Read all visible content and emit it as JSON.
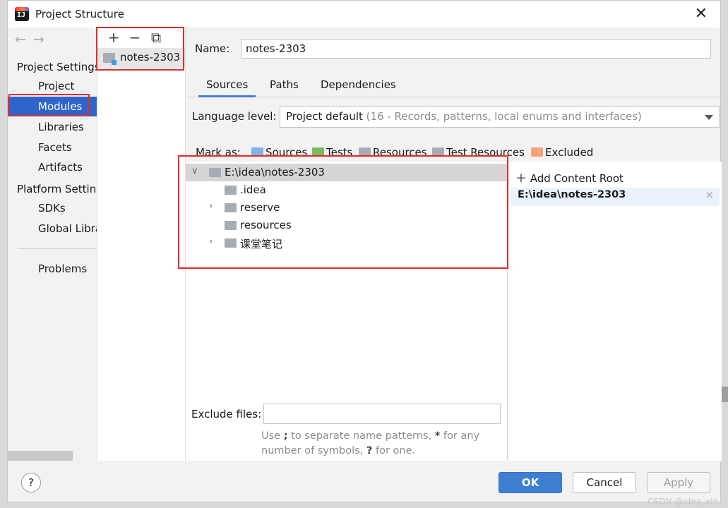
{
  "window": {
    "title": "Project Structure",
    "close": "✕"
  },
  "nav": {
    "project_settings": "Project Settings",
    "items1": [
      "Project",
      "Modules",
      "Libraries",
      "Facets",
      "Artifacts"
    ],
    "platform_settings": "Platform Settings",
    "items2": [
      "SDKs",
      "Global Libraries"
    ],
    "problems": "Problems",
    "selected": "Modules"
  },
  "modules": {
    "toolbar": {
      "add": "+",
      "remove": "−",
      "copy": "⧉"
    },
    "list": [
      "notes-2303"
    ]
  },
  "name": {
    "label": "Name:",
    "value": "notes-2303"
  },
  "tabs": [
    "Sources",
    "Paths",
    "Dependencies"
  ],
  "language": {
    "label": "Language level:",
    "value": "Project default",
    "detail": "(16 - Records, patterns, local enums and interfaces)"
  },
  "mark_as": {
    "label": "Mark as:",
    "buttons": [
      {
        "label": "Sources",
        "color": "#7fb2e5"
      },
      {
        "label": "Tests",
        "color": "#7cba5e"
      },
      {
        "label": "Resources",
        "color": "#a6acb3"
      },
      {
        "label": "Test Resources",
        "color": "#a6acb3"
      },
      {
        "label": "Excluded",
        "color": "#f5a27a"
      }
    ]
  },
  "tree": {
    "root": "E:\\idea\\notes-2303",
    "children": [
      ".idea",
      "reserve",
      "resources",
      "课堂笔记"
    ]
  },
  "exclude": {
    "label": "Exclude files:",
    "hint_a": "Use ",
    "hint_semicolon": ";",
    "hint_b": " to separate name patterns, ",
    "hint_star": "*",
    "hint_c": " for any number of symbols, ",
    "hint_q": "?",
    "hint_d": " for one."
  },
  "content_root": {
    "add": "Add Content Root",
    "path": "E:\\idea\\notes-2303",
    "remove": "×"
  },
  "buttons": {
    "help": "?",
    "ok": "OK",
    "cancel": "Cancel",
    "apply": "Apply"
  },
  "watermark": "CSDN @idea_xin"
}
